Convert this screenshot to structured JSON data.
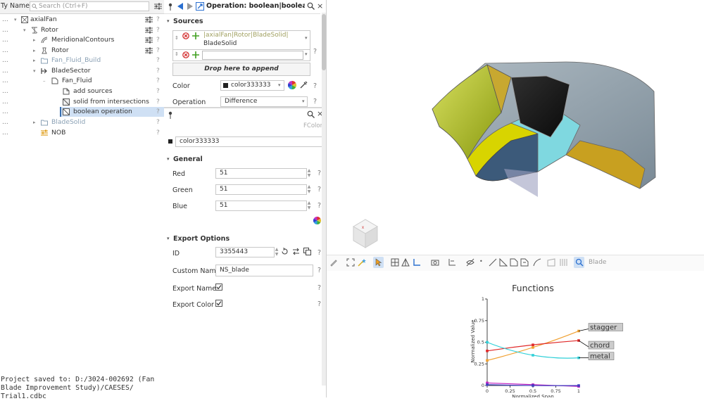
{
  "tree": {
    "header_col1": "Ty",
    "header_col2": "Name",
    "search_placeholder": "Search (Ctrl+F)",
    "rows": [
      {
        "label": "axialFan"
      },
      {
        "label": "Rotor"
      },
      {
        "label": "MeridionalContours"
      },
      {
        "label": "Rotor"
      },
      {
        "label": "Fan_Fluid_Build"
      },
      {
        "label": "BladeSector"
      },
      {
        "label": "Fan_Fluid"
      },
      {
        "label": "add sources"
      },
      {
        "label": "solid from intersections"
      },
      {
        "label": "boolean operation"
      },
      {
        "label": "BladeSolid"
      },
      {
        "label": "NOB"
      }
    ],
    "dots": "...",
    "qmark": "?"
  },
  "status": {
    "line1": "Project saved to: D:/3024-002692 (Fan Blade Improvement Study)/CAESES/",
    "line2": "Trial1.cdbc"
  },
  "operation": {
    "title": "Operation: boolean|boolean ope",
    "sources_label": "Sources",
    "source1_line1": "|axialFan|Rotor|BladeSolid|",
    "source1_line2": "BladeSolid",
    "drop_label": "Drop here to append",
    "color_label": "Color",
    "color_value": "color333333",
    "operation_label": "Operation",
    "operation_value": "Difference"
  },
  "fcolor": {
    "type_label": "FColor",
    "name": "color333333",
    "general_label": "General",
    "red_label": "Red",
    "red_value": "51",
    "green_label": "Green",
    "green_value": "51",
    "blue_label": "Blue",
    "blue_value": "51",
    "export_label": "Export Options",
    "id_label": "ID",
    "id_value": "3355443",
    "custom_name_label": "Custom Name",
    "custom_name_value": "NS_blade",
    "export_name_label": "Export Name",
    "export_color_label": "Export Color"
  },
  "viewer": {
    "search_placeholder": "Blade",
    "cube_x": "x"
  },
  "chart_data": {
    "type": "line",
    "title": "Functions",
    "xlabel": "Normalized Span",
    "ylabel": "Normalized Value",
    "xlim": [
      0,
      1
    ],
    "ylim": [
      0,
      1
    ],
    "xticks": [
      "0",
      "0.25",
      "0.5",
      "0.75",
      "1"
    ],
    "yticks": [
      "0",
      "0.25",
      "0.5",
      "0.75",
      "1"
    ],
    "series": [
      {
        "name": "stagger",
        "color": "#f0a030",
        "x": [
          0,
          0.5,
          1
        ],
        "y": [
          0.29,
          0.44,
          0.63
        ]
      },
      {
        "name": "chord",
        "color": "#e02828",
        "x": [
          0,
          0.5,
          1
        ],
        "y": [
          0.4,
          0.47,
          0.52
        ]
      },
      {
        "name": "metal",
        "color": "#30d0d8",
        "x": [
          0,
          0.5,
          1
        ],
        "y": [
          0.5,
          0.35,
          0.32
        ]
      },
      {
        "color": "#c020c0",
        "x": [
          0,
          0.5,
          1
        ],
        "y": [
          0.03,
          0.01,
          -0.01
        ]
      },
      {
        "color": "#4040c0",
        "x": [
          0,
          0.5,
          1
        ],
        "y": [
          0.01,
          0.0,
          0.0
        ]
      }
    ]
  }
}
